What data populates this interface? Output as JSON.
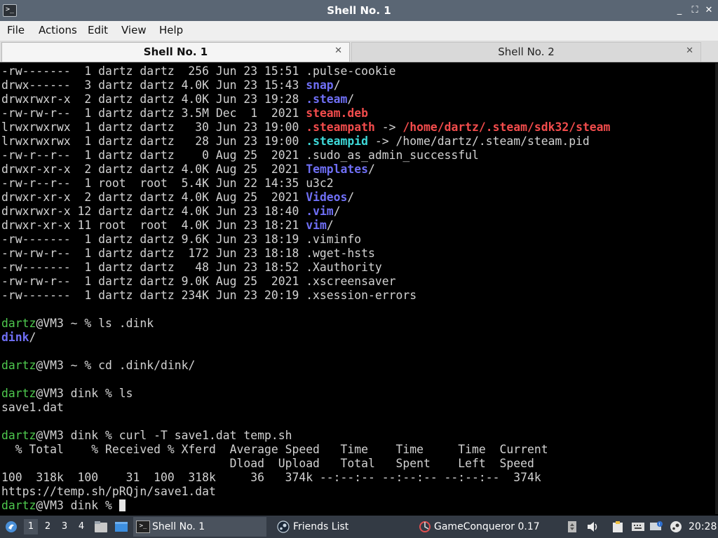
{
  "window": {
    "title": "Shell No. 1",
    "controls": {
      "minimize": "_",
      "maximize": "⛶",
      "close": "✕"
    }
  },
  "menubar": {
    "items": [
      "File",
      "Actions",
      "Edit",
      "View",
      "Help"
    ]
  },
  "tabs": [
    {
      "label": "Shell No. 1",
      "active": true
    },
    {
      "label": "Shell No. 2",
      "active": false
    }
  ],
  "terminal": {
    "lines": [
      [
        {
          "t": "-rw-------  1 dartz dartz  256 Jun 23 15:51 .pulse-cookie"
        }
      ],
      [
        {
          "t": "drwx------  3 dartz dartz 4.0K Jun 23 15:43 "
        },
        {
          "t": "snap",
          "c": "blue"
        },
        {
          "t": "/"
        }
      ],
      [
        {
          "t": "drwxrwxr-x  2 dartz dartz 4.0K Jun 23 19:28 "
        },
        {
          "t": ".steam",
          "c": "blue"
        },
        {
          "t": "/"
        }
      ],
      [
        {
          "t": "-rw-rw-r--  1 dartz dartz 3.5M Dec  1  2021 "
        },
        {
          "t": "steam.deb",
          "c": "red"
        }
      ],
      [
        {
          "t": "lrwxrwxrwx  1 dartz dartz   30 Jun 23 19:00 "
        },
        {
          "t": ".steampath",
          "c": "red"
        },
        {
          "t": " -> "
        },
        {
          "t": "/home/dartz/.steam/sdk32/steam",
          "c": "red"
        }
      ],
      [
        {
          "t": "lrwxrwxrwx  1 dartz dartz   28 Jun 23 19:00 "
        },
        {
          "t": ".steampid",
          "c": "cyan"
        },
        {
          "t": " -> /home/dartz/.steam/steam.pid"
        }
      ],
      [
        {
          "t": "-rw-r--r--  1 dartz dartz    0 Aug 25  2021 .sudo_as_admin_successful"
        }
      ],
      [
        {
          "t": "drwxr-xr-x  2 dartz dartz 4.0K Aug 25  2021 "
        },
        {
          "t": "Templates",
          "c": "blue"
        },
        {
          "t": "/"
        }
      ],
      [
        {
          "t": "-rw-r--r--  1 root  root  5.4K Jun 22 14:35 u3c2"
        }
      ],
      [
        {
          "t": "drwxr-xr-x  2 dartz dartz 4.0K Aug 25  2021 "
        },
        {
          "t": "Videos",
          "c": "blue"
        },
        {
          "t": "/"
        }
      ],
      [
        {
          "t": "drwxrwxr-x 12 dartz dartz 4.0K Jun 23 18:40 "
        },
        {
          "t": ".vim",
          "c": "blue"
        },
        {
          "t": "/"
        }
      ],
      [
        {
          "t": "drwxr-xr-x 11 root  root  4.0K Jun 23 18:21 "
        },
        {
          "t": "vim",
          "c": "blue"
        },
        {
          "t": "/"
        }
      ],
      [
        {
          "t": "-rw-------  1 dartz dartz 9.6K Jun 23 18:19 .viminfo"
        }
      ],
      [
        {
          "t": "-rw-rw-r--  1 dartz dartz  172 Jun 23 18:18 .wget-hsts"
        }
      ],
      [
        {
          "t": "-rw-------  1 dartz dartz   48 Jun 23 18:52 .Xauthority"
        }
      ],
      [
        {
          "t": "-rw-rw-r--  1 dartz dartz 9.0K Aug 25  2021 .xscreensaver"
        }
      ],
      [
        {
          "t": "-rw-------  1 dartz dartz 234K Jun 23 20:19 .xsession-errors"
        }
      ],
      [],
      [
        {
          "t": "dartz",
          "c": "green"
        },
        {
          "t": "@VM3 ~ % ls .dink"
        }
      ],
      [
        {
          "t": "dink",
          "c": "blue"
        },
        {
          "t": "/"
        }
      ],
      [],
      [
        {
          "t": "dartz",
          "c": "green"
        },
        {
          "t": "@VM3 ~ % cd .dink/dink/"
        }
      ],
      [],
      [
        {
          "t": "dartz",
          "c": "green"
        },
        {
          "t": "@VM3 dink % ls"
        }
      ],
      [
        {
          "t": "save1.dat"
        }
      ],
      [],
      [
        {
          "t": "dartz",
          "c": "green"
        },
        {
          "t": "@VM3 dink % curl -T save1.dat temp.sh"
        }
      ],
      [
        {
          "t": "  % Total    % Received % Xferd  Average Speed   Time    Time     Time  Current"
        }
      ],
      [
        {
          "t": "                                 Dload  Upload   Total   Spent    Left  Speed"
        }
      ],
      [
        {
          "t": "100  318k  100    31  100  318k     36   374k --:--:-- --:--:-- --:--:--  374k"
        }
      ],
      [
        {
          "t": "https://temp.sh/pRQjn/save1.dat"
        }
      ],
      [
        {
          "t": "dartz",
          "c": "green"
        },
        {
          "t": "@VM3 dink % "
        },
        {
          "cursor": true
        }
      ]
    ]
  },
  "taskbar": {
    "workspaces": [
      "1",
      "2",
      "3",
      "4"
    ],
    "tasks": [
      {
        "label": "Shell No. 1",
        "icon": "terminal-icon"
      },
      {
        "label": "Friends List",
        "icon": "steam-icon"
      },
      {
        "label": "GameConqueror 0.17",
        "icon": "gameconqueror-icon"
      }
    ],
    "clock": "20:28"
  },
  "colors": {
    "titlebar": "#5a6674",
    "taskbar": "#333a44",
    "prompt_green": "#4ec94e",
    "dir_blue": "#6f6ff5",
    "link_red": "#f24c4c",
    "link_cyan": "#3ed9d9"
  }
}
